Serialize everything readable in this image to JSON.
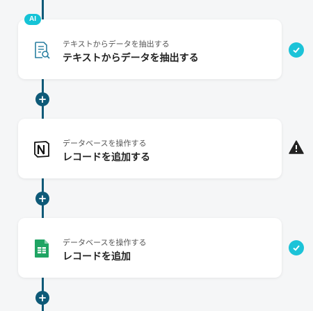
{
  "steps": [
    {
      "badge": "AI",
      "subtitle": "テキストからデータを抽出する",
      "title": "テキストからデータを抽出する",
      "icon": "document-search-icon",
      "status": "check-icon"
    },
    {
      "subtitle": "データベースを操作する",
      "title": "レコードを追加する",
      "icon": "notion-icon",
      "status": "warning-icon"
    },
    {
      "subtitle": "データベースを操作する",
      "title": "レコードを追加",
      "icon": "google-sheets-icon",
      "status": "check-icon"
    }
  ],
  "add_button_label": "+",
  "colors": {
    "flow_line": "#0e5a78",
    "ai_badge": "#15c3d6",
    "check": "#1cc3d8",
    "warning": "#222222",
    "sheets_green": "#1fa463"
  }
}
